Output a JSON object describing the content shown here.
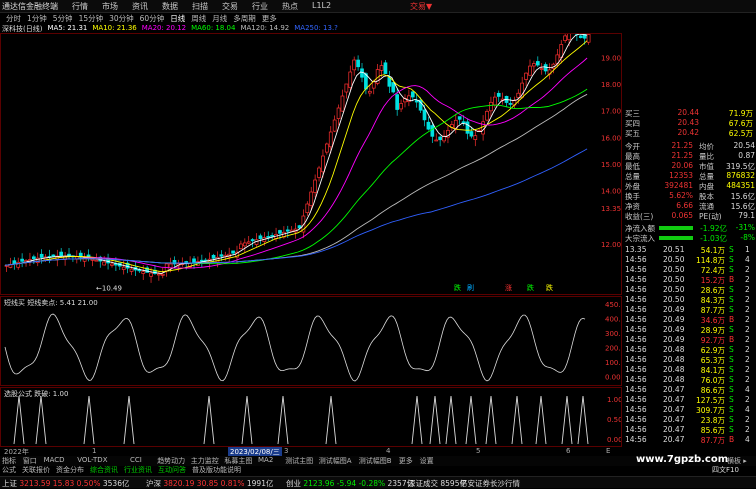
{
  "menubar": {
    "app_title": "通达信金融终端",
    "items": [
      "行情",
      "市场",
      "资讯",
      "数据",
      "扫描",
      "交易",
      "行业",
      "热点",
      "L1L2"
    ],
    "right_label": "交易▼"
  },
  "periods": [
    "分时",
    "1分钟",
    "5分钟",
    "15分钟",
    "30分钟",
    "60分钟",
    "日线",
    "周线",
    "月线",
    "多周期",
    "更多"
  ],
  "active_period": "日线",
  "ma_legend": {
    "stock": "深科技(日线)",
    "ma5": "MA5: 21.31",
    "ma10": "MA10: 21.36",
    "ma20": "MA20: 20.12",
    "ma60": "MA60: 18.04",
    "ma120": "MA120: 14.92",
    "ma250": "MA250: 13.?"
  },
  "colors": {
    "up": "#ff3030",
    "down": "#00e0e0",
    "ma5": "#ffffff",
    "ma10": "#ffff00",
    "ma20": "#ff00ff",
    "ma60": "#00ff00",
    "ma120": "#bbbbbb",
    "ma250": "#3060ff"
  },
  "main_chart": {
    "price_labels": [
      "19.00",
      "18.00",
      "17.00",
      "16.00",
      "15.00",
      "14.00",
      "13.35",
      "12.00"
    ],
    "low_label": "←10.49",
    "signal_labels": [
      "跌",
      "刷",
      "涨",
      "跌",
      "跌"
    ]
  },
  "ind1": {
    "title": "短线买  短线卖点: 5.41  21.00",
    "axis": [
      "450.0",
      "400.0",
      "300.0",
      "200.0",
      "100.0",
      "0.00"
    ]
  },
  "ind2": {
    "title": "选股公式  跌破: 1.00",
    "axis": [
      "1.00",
      "0.50",
      "0.00"
    ]
  },
  "timeline": {
    "labels": [
      "2022年",
      "1",
      "2023/02/08/三",
      "3",
      "4",
      "5",
      "6",
      "E"
    ]
  },
  "orderbook": [
    {
      "k": "买三",
      "v": "20.44",
      "v2": "71.9万"
    },
    {
      "k": "买四",
      "v": "20.43",
      "v2": "67.6万"
    },
    {
      "k": "买五",
      "v": "20.42",
      "v2": "62.5万"
    }
  ],
  "stats": [
    {
      "k1": "今开",
      "v1": "21.25",
      "k2": "均价",
      "v2": "20.54"
    },
    {
      "k1": "最高",
      "v1": "21.25",
      "k2": "量比",
      "v2": "0.87"
    },
    {
      "k1": "最低",
      "v1": "20.06",
      "k2": "市值",
      "v2": "319.5亿"
    },
    {
      "k1": "总量",
      "v1": "12353",
      "k2": "总量",
      "v2": "876832"
    },
    {
      "k1": "外盘",
      "v1": "392481",
      "k2": "内盘",
      "v2": "484351"
    },
    {
      "k1": "换手",
      "v1": "5.62%",
      "k2": "股本",
      "v2": "15.6亿"
    },
    {
      "k1": "净资",
      "v1": "6.66",
      "k2": "流通",
      "v2": "15.6亿"
    },
    {
      "k1": "收益(三)",
      "v1": "0.065",
      "k2": "PE(动)",
      "v2": "79.1"
    }
  ],
  "flows": [
    {
      "k": "净流入额",
      "v": "-1.92亿",
      "p": "-31%"
    },
    {
      "k": "大宗流入",
      "v": "-1.03亿",
      "p": "-8%"
    }
  ],
  "ticks": [
    [
      "13.35",
      "20.51",
      "54.1万",
      "S",
      "1"
    ],
    [
      "14:56",
      "20.50",
      "114.8万",
      "S",
      "4"
    ],
    [
      "14:56",
      "20.50",
      "72.4万",
      "S",
      "2"
    ],
    [
      "14:56",
      "20.50",
      "15.2万",
      "B",
      "2"
    ],
    [
      "14:56",
      "20.50",
      "28.6万",
      "S",
      "2"
    ],
    [
      "14:56",
      "20.50",
      "84.3万",
      "S",
      "2"
    ],
    [
      "14:56",
      "20.49",
      "87.7万",
      "S",
      "2"
    ],
    [
      "14:56",
      "20.49",
      "34.6万",
      "B",
      "2"
    ],
    [
      "14:56",
      "20.49",
      "28.9万",
      "S",
      "2"
    ],
    [
      "14:56",
      "20.49",
      "92.7万",
      "B",
      "2"
    ],
    [
      "14:56",
      "20.48",
      "62.9万",
      "S",
      "2"
    ],
    [
      "14:56",
      "20.48",
      "65.3万",
      "S",
      "2"
    ],
    [
      "14:56",
      "20.48",
      "84.1万",
      "S",
      "2"
    ],
    [
      "14:56",
      "20.48",
      "76.0万",
      "S",
      "2"
    ],
    [
      "14:56",
      "20.47",
      "86.6万",
      "S",
      "4"
    ],
    [
      "14:56",
      "20.47",
      "127.5万",
      "S",
      "2"
    ],
    [
      "14:56",
      "20.47",
      "309.7万",
      "S",
      "4"
    ],
    [
      "14:56",
      "20.47",
      "23.8万",
      "S",
      "2"
    ],
    [
      "14:56",
      "20.47",
      "85.6万",
      "S",
      "2"
    ],
    [
      "14:56",
      "20.47",
      "87.7万",
      "B",
      "4"
    ]
  ],
  "tabs": [
    "指标",
    "窗口",
    "MACD",
    "VOL-TDX",
    "CCI",
    "趋势动力",
    "主力监控",
    "私募主图",
    "MA2",
    "测试主图",
    "测试幅图A",
    "测试幅图B",
    "更多",
    "设置"
  ],
  "links": [
    "公式",
    "关联报价",
    "资金分布",
    "综合资讯",
    "行业资讯",
    "互动问答",
    "普及版功能说明"
  ],
  "tabs_right": "横板 ▸",
  "statusbar": [
    {
      "label": "上证",
      "value": "3213.59",
      "chg": "15.83",
      "pct": "0.50%",
      "amt": "3536亿"
    },
    {
      "label": "沪深",
      "value": "3820.19",
      "chg": "30.85",
      "pct": "0.81%",
      "amt": "1991亿"
    },
    {
      "label": "创业",
      "value": "2123.96",
      "chg": "-5.94",
      "pct": "-0.28%",
      "amt": "2357亿"
    },
    {
      "label": "深证成交",
      "value": "8595亿",
      "chg": "",
      "pct": "",
      "amt": ""
    }
  ],
  "status_right": "平安证券长沙行情",
  "status_tag": "四文F10",
  "watermark": "www.7gpzb.com"
}
